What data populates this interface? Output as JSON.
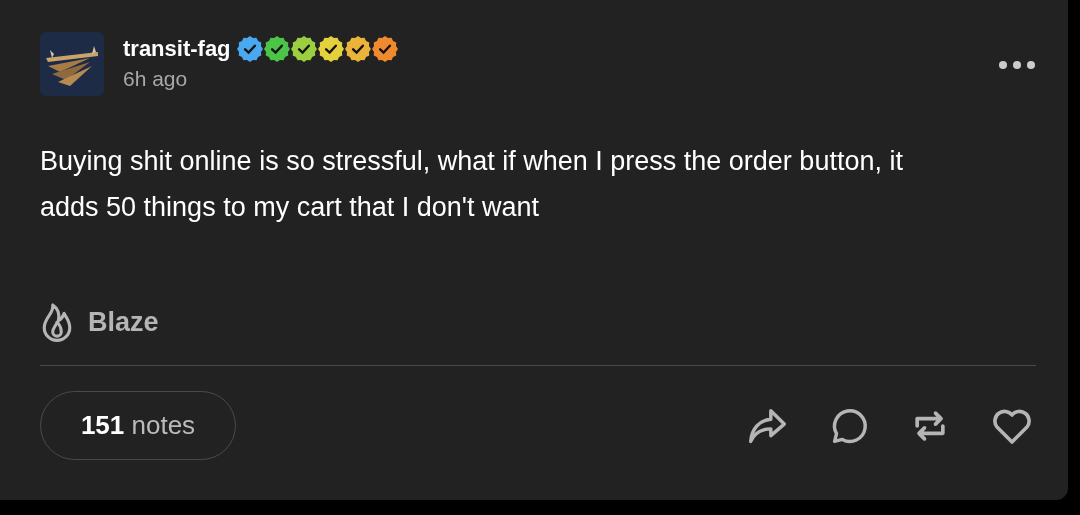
{
  "post": {
    "blog_name": "transit-fag",
    "badges": [
      {
        "color": "#4aa8f0"
      },
      {
        "color": "#4cc447"
      },
      {
        "color": "#9ccf3f"
      },
      {
        "color": "#e3d23d"
      },
      {
        "color": "#eab33a"
      },
      {
        "color": "#ef8a2e"
      }
    ],
    "time": "6h ago",
    "body": "Buying shit online is so stressful, what if when I press the order button, it adds 50 things to my cart that I don't want",
    "blaze": "Blaze",
    "notes": "**151** notes"
  }
}
